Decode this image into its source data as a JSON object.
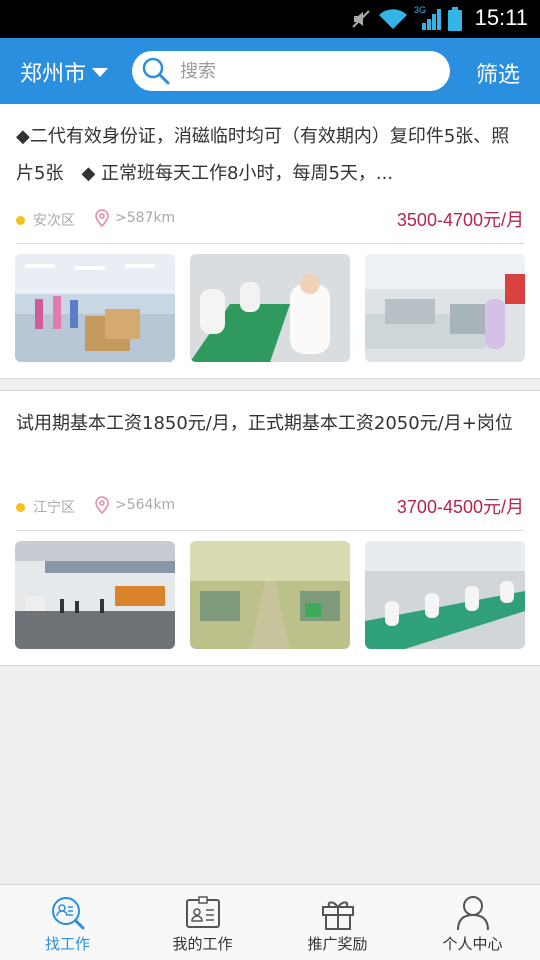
{
  "status_bar": {
    "time": "15:11",
    "network": "3G"
  },
  "header": {
    "city": "郑州市",
    "search_placeholder": "搜索",
    "filter_label": "筛选"
  },
  "jobs": [
    {
      "description": "◆二代有效身份证，消磁临时均可（有效期内）复印件5张、照片5张　◆ 正常班每天工作8小时，每周5天，...",
      "district": "安次区",
      "distance": ">587km",
      "salary": "3500-4700元/月"
    },
    {
      "description": "试用期基本工资1850元/月，正式期基本工资2050元/月+岗位",
      "district": "江宁区",
      "distance": ">564km",
      "salary": "3700-4500元/月"
    }
  ],
  "tabs": [
    {
      "label": "找工作",
      "icon": "find-job-icon",
      "active": true
    },
    {
      "label": "我的工作",
      "icon": "my-job-icon",
      "active": false
    },
    {
      "label": "推广奖励",
      "icon": "gift-icon",
      "active": false
    },
    {
      "label": "个人中心",
      "icon": "person-icon",
      "active": false
    }
  ],
  "colors": {
    "header": "#2b8fe0",
    "salary": "#b8234a",
    "dot": "#f6c21a",
    "active_tab": "#2b8fe0"
  }
}
